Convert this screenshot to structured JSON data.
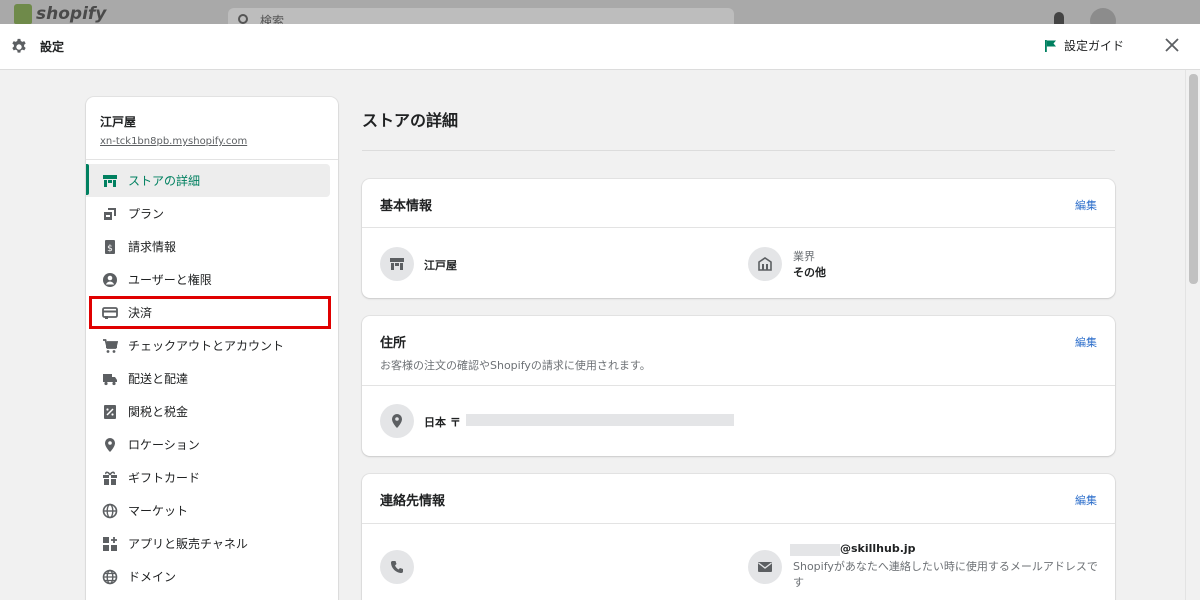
{
  "topbar": {
    "logo_text": "shopify",
    "search_placeholder": "検索"
  },
  "modal": {
    "title": "設定",
    "guide_label": "設定ガイド"
  },
  "sidebar": {
    "store_name": "江戸屋",
    "store_domain": "xn-tck1bn8pb.myshopify.com",
    "items": [
      {
        "label": "ストアの詳細",
        "icon": "store-icon",
        "active": true
      },
      {
        "label": "プラン",
        "icon": "plan-icon"
      },
      {
        "label": "請求情報",
        "icon": "billing-icon"
      },
      {
        "label": "ユーザーと権限",
        "icon": "user-icon"
      },
      {
        "label": "決済",
        "icon": "payment-icon",
        "highlighted": true
      },
      {
        "label": "チェックアウトとアカウント",
        "icon": "cart-icon"
      },
      {
        "label": "配送と配達",
        "icon": "truck-icon"
      },
      {
        "label": "関税と税金",
        "icon": "tax-icon"
      },
      {
        "label": "ロケーション",
        "icon": "location-icon"
      },
      {
        "label": "ギフトカード",
        "icon": "gift-icon"
      },
      {
        "label": "マーケット",
        "icon": "globe-icon"
      },
      {
        "label": "アプリと販売チャネル",
        "icon": "apps-icon"
      },
      {
        "label": "ドメイン",
        "icon": "domain-icon"
      }
    ]
  },
  "main": {
    "title": "ストアの詳細",
    "basic": {
      "title": "基本情報",
      "edit": "編集",
      "store_name": "江戸屋",
      "industry_label": "業界",
      "industry_value": "その他"
    },
    "address": {
      "title": "住所",
      "subtitle": "お客様の注文の確認やShopifyの請求に使用されます。",
      "edit": "編集",
      "value": "日本 〒"
    },
    "contact": {
      "title": "連絡先情報",
      "edit": "編集",
      "email_suffix": "@skillhub.jp",
      "email_note": "Shopifyがあなたへ連絡したい時に使用するメールアドレスです"
    }
  },
  "colors": {
    "accent": "#008060",
    "link": "#2c6ecb",
    "highlight_box": "#e00000",
    "guide_flag": "#008060"
  }
}
